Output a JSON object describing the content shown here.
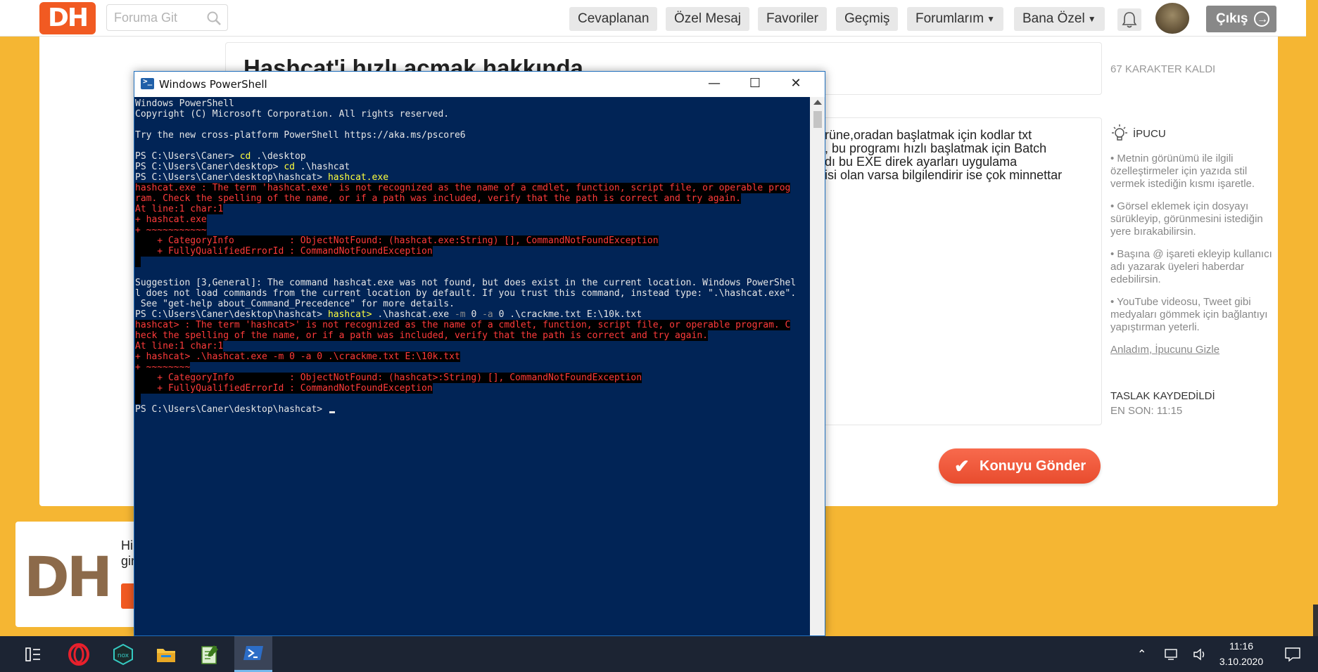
{
  "site": {
    "logo": "DH",
    "search_placeholder": "Foruma Git",
    "nav": [
      "Cevaplanan",
      "Özel Mesaj",
      "Favoriler",
      "Geçmiş",
      "Forumlarım",
      "Bana Özel"
    ],
    "logout_label": "Çıkış"
  },
  "post": {
    "title": "Hashcat'i hızlı açmak hakkında",
    "chars_left": "67 KARAKTER KALDI",
    "body_lines": [
      "rüne,oradan başlatmak için kodlar txt",
      ", bu programı hızlı başlatmak için Batch",
      "dı bu EXE direk ayarları uygulama",
      "isi olan varsa bilgilendirir ise çok minnettar"
    ],
    "send_label": "Konuyu Gönder"
  },
  "tips": {
    "title": "İPUCU",
    "items": [
      "• Metnin görünümü ile ilgili özelleştirmeler için yazıda stil vermek istediğin kısmı işaretle.",
      "• Görsel eklemek için dosyayı sürükleyip, görünmesini istediğin yere bırakabilirsin.",
      "• Başına @ işareti ekleyip kullanıcı adı yazarak üyeleri haberdar edebilirsin.",
      "• YouTube videosu, Tweet gibi medyaları gömmek için bağlantıyı yapıştırman yeterli."
    ],
    "hide_label": "Anladım, İpucunu Gizle"
  },
  "draft": {
    "title": "TASLAK KAYDEDİLDİ",
    "time": "EN SON: 11:15"
  },
  "promo": {
    "logo": "DH",
    "line1": "Hi",
    "line2": "gir"
  },
  "powershell": {
    "title": "Windows PowerShell",
    "controls": {
      "minimize": "—",
      "maximize": "☐",
      "close": "✕"
    },
    "console": [
      [
        {
          "t": "Windows PowerShell",
          "c": "n"
        }
      ],
      [
        {
          "t": "Copyright (C) Microsoft Corporation. All rights reserved.",
          "c": "n"
        }
      ],
      [
        {
          "t": "",
          "c": "n"
        }
      ],
      [
        {
          "t": "Try the new cross-platform PowerShell https://aka.ms/pscore6",
          "c": "n"
        }
      ],
      [
        {
          "t": "",
          "c": "n"
        }
      ],
      [
        {
          "t": "PS C:\\Users\\Caner> ",
          "c": "n"
        },
        {
          "t": "cd",
          "c": "y"
        },
        {
          "t": " .\\desktop",
          "c": "n"
        }
      ],
      [
        {
          "t": "PS C:\\Users\\Caner\\desktop> ",
          "c": "n"
        },
        {
          "t": "cd",
          "c": "y"
        },
        {
          "t": " .\\hashcat",
          "c": "n"
        }
      ],
      [
        {
          "t": "PS C:\\Users\\Caner\\desktop\\hashcat> ",
          "c": "n"
        },
        {
          "t": "hashcat.exe",
          "c": "y"
        }
      ],
      [
        {
          "t": "hashcat.exe : The term 'hashcat.exe' is not recognized as the name of a cmdlet, function, script file, or operable prog",
          "c": "e"
        }
      ],
      [
        {
          "t": "ram. Check the spelling of the name, or if a path was included, verify that the path is correct and try again.",
          "c": "e"
        }
      ],
      [
        {
          "t": "At line:1 char:1",
          "c": "e"
        }
      ],
      [
        {
          "t": "+ hashcat.exe",
          "c": "e"
        }
      ],
      [
        {
          "t": "+ ~~~~~~~~~~~",
          "c": "e"
        }
      ],
      [
        {
          "t": "    + CategoryInfo          : ObjectNotFound: (hashcat.exe:String) [], CommandNotFoundException",
          "c": "e"
        }
      ],
      [
        {
          "t": "    + FullyQualifiedErrorId : CommandNotFoundException",
          "c": "e"
        }
      ],
      [
        {
          "t": " ",
          "c": "e"
        }
      ],
      [
        {
          "t": "",
          "c": "n"
        }
      ],
      [
        {
          "t": "Suggestion [3,General]: The command hashcat.exe was not found, but does exist in the current location. Windows PowerShel",
          "c": "n"
        }
      ],
      [
        {
          "t": "l does not load commands from the current location by default. If you trust this command, instead type: \".\\hashcat.exe\".",
          "c": "n"
        }
      ],
      [
        {
          "t": " See \"get-help about_Command_Precedence\" for more details.",
          "c": "n"
        }
      ],
      [
        {
          "t": "PS C:\\Users\\Caner\\desktop\\hashcat> ",
          "c": "n"
        },
        {
          "t": "hashcat>",
          "c": "y"
        },
        {
          "t": " .\\hashcat.exe ",
          "c": "n"
        },
        {
          "t": "-m",
          "c": "g"
        },
        {
          "t": " 0 ",
          "c": "n"
        },
        {
          "t": "-a",
          "c": "g"
        },
        {
          "t": " 0 .\\crackme.txt E:\\10k.txt",
          "c": "n"
        }
      ],
      [
        {
          "t": "hashcat> : The term 'hashcat>' is not recognized as the name of a cmdlet, function, script file, or operable program. C",
          "c": "e"
        }
      ],
      [
        {
          "t": "heck the spelling of the name, or if a path was included, verify that the path is correct and try again.",
          "c": "e"
        }
      ],
      [
        {
          "t": "At line:1 char:1",
          "c": "e"
        }
      ],
      [
        {
          "t": "+ hashcat> .\\hashcat.exe -m 0 -a 0 .\\crackme.txt E:\\10k.txt",
          "c": "e"
        }
      ],
      [
        {
          "t": "+ ~~~~~~~~",
          "c": "e"
        }
      ],
      [
        {
          "t": "    + CategoryInfo          : ObjectNotFound: (hashcat>:String) [], CommandNotFoundException",
          "c": "e"
        }
      ],
      [
        {
          "t": "    + FullyQualifiedErrorId : CommandNotFoundException",
          "c": "e"
        }
      ],
      [
        {
          "t": " ",
          "c": "e"
        }
      ],
      [
        {
          "t": "PS C:\\Users\\Caner\\desktop\\hashcat> ",
          "c": "n"
        }
      ]
    ]
  },
  "taskbar": {
    "apps": [
      "task-view",
      "opera",
      "nox",
      "file-explorer",
      "notepad",
      "powershell"
    ],
    "time": "11:16",
    "date": "3.10.2020"
  },
  "colors": {
    "page_bg": "#f5b633",
    "brand": "#f15a22",
    "ps_bg": "#012456",
    "ps_error": "#ff3b3b",
    "ps_command": "#ffff3d",
    "taskbar": "#1c2433"
  }
}
